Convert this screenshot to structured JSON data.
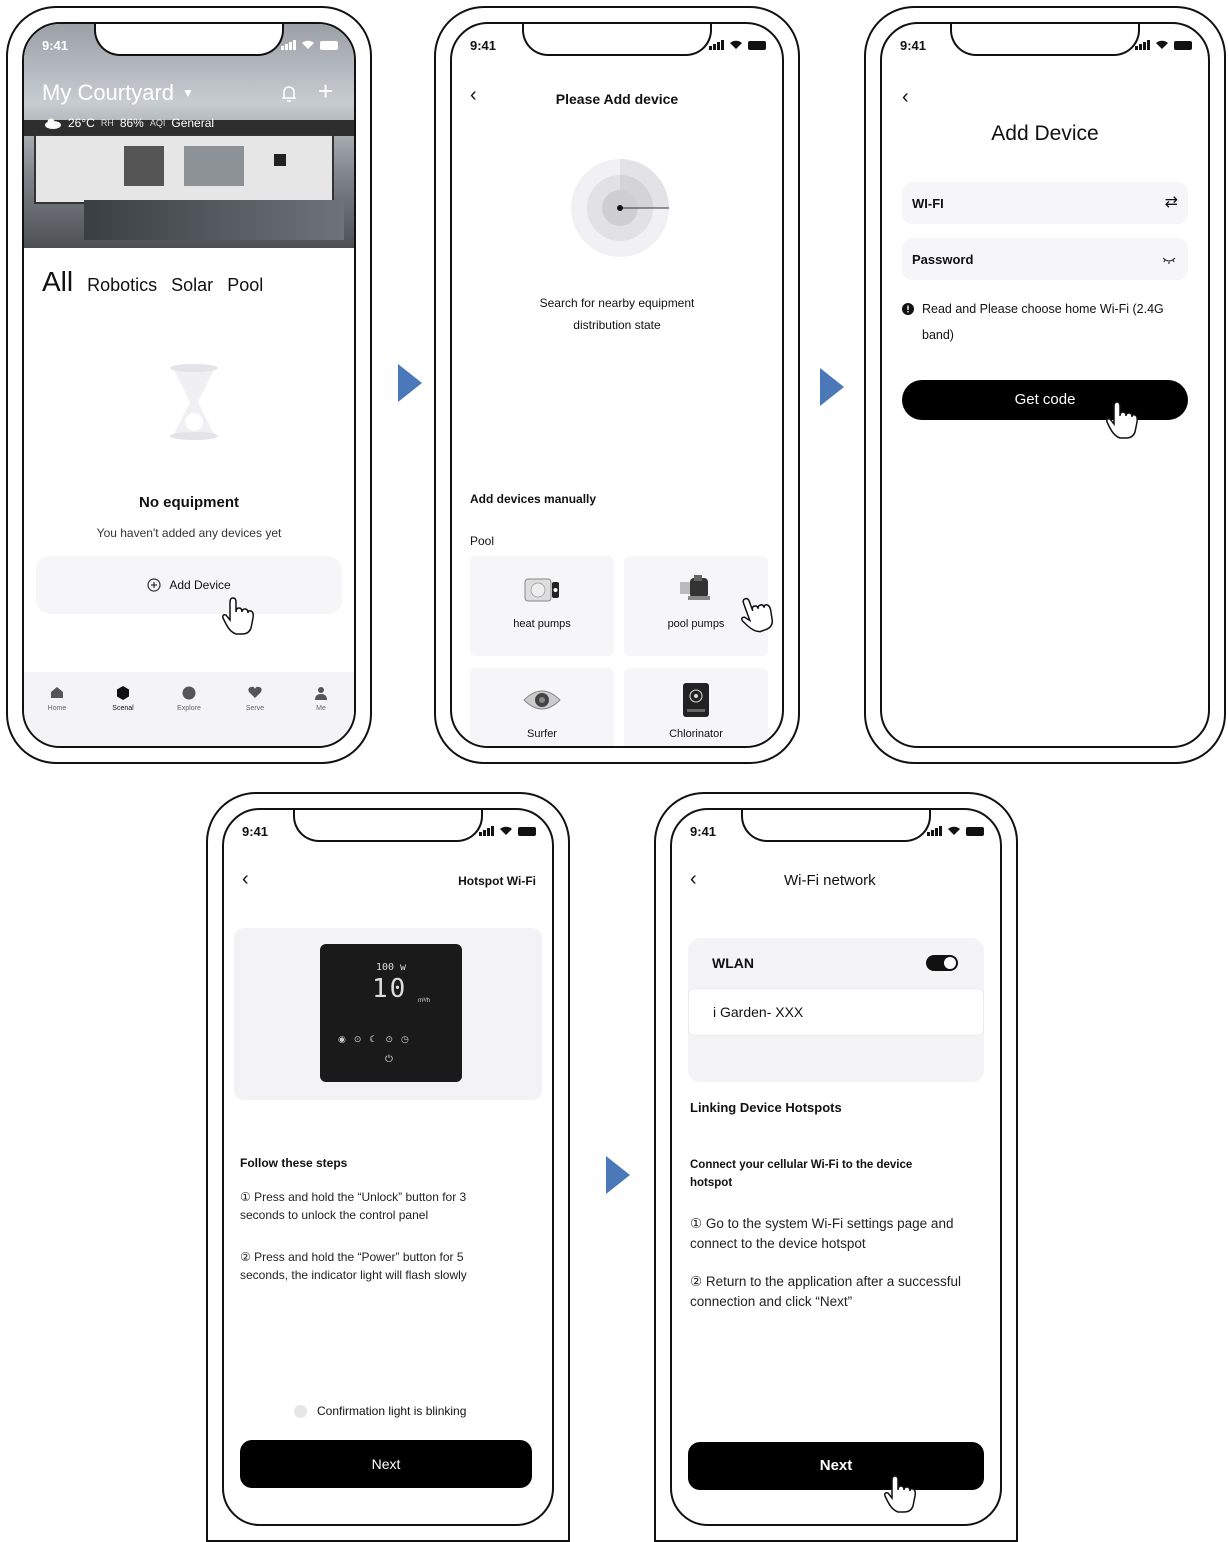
{
  "status_time": "9:41",
  "screen1": {
    "header_title": "My Courtyard",
    "weather_temp": "26°C",
    "humidity_label": "RH",
    "humidity_value": "86%",
    "aqi_label": "AQI",
    "aqi_value": "General",
    "tabs": [
      "All",
      "Robotics",
      "Solar",
      "Pool"
    ],
    "empty_title": "No equipment",
    "empty_subtitle": "You haven't added any devices yet",
    "add_device_label": "Add Device",
    "nav": [
      "Home",
      "Scenal",
      "Explore",
      "Serve",
      "Me"
    ]
  },
  "screen2": {
    "title": "Please Add device",
    "search_line1": "Search for nearby equipment",
    "search_line2": "distribution state",
    "manual_heading": "Add devices manually",
    "category": "Pool",
    "devices": [
      "heat pumps",
      "pool pumps",
      "Surfer",
      "Chlorinator"
    ]
  },
  "screen3": {
    "title": "Add Device",
    "wifi_label": "WI-FI",
    "password_label": "Password",
    "notice": "Read and Please choose home Wi-Fi (2.4G band)",
    "button": "Get code"
  },
  "screen4": {
    "title": "Hotspot Wi-Fi",
    "display_power": "100 w",
    "display_flow": "10",
    "display_unit": "m³/h",
    "steps_heading": "Follow these steps",
    "step1": "① Press and hold the “Unlock” button for 3 seconds to unlock the control panel",
    "step2": "② Press and hold the “Power” button for 5 seconds, the indicator light will flash slowly",
    "confirm_label": "Confirmation light is blinking",
    "button": "Next"
  },
  "screen5": {
    "title": "Wi-Fi network",
    "wlan_label": "WLAN",
    "network_name": "i Garden- XXX",
    "section_heading": "Linking Device Hotspots",
    "instruction": "Connect your cellular Wi-Fi to the device hotspot",
    "step1": "① Go to the system Wi-Fi settings page and connect to the device hotspot",
    "step2": "② Return to the application after a successful connection and click “Next”",
    "button": "Next"
  }
}
